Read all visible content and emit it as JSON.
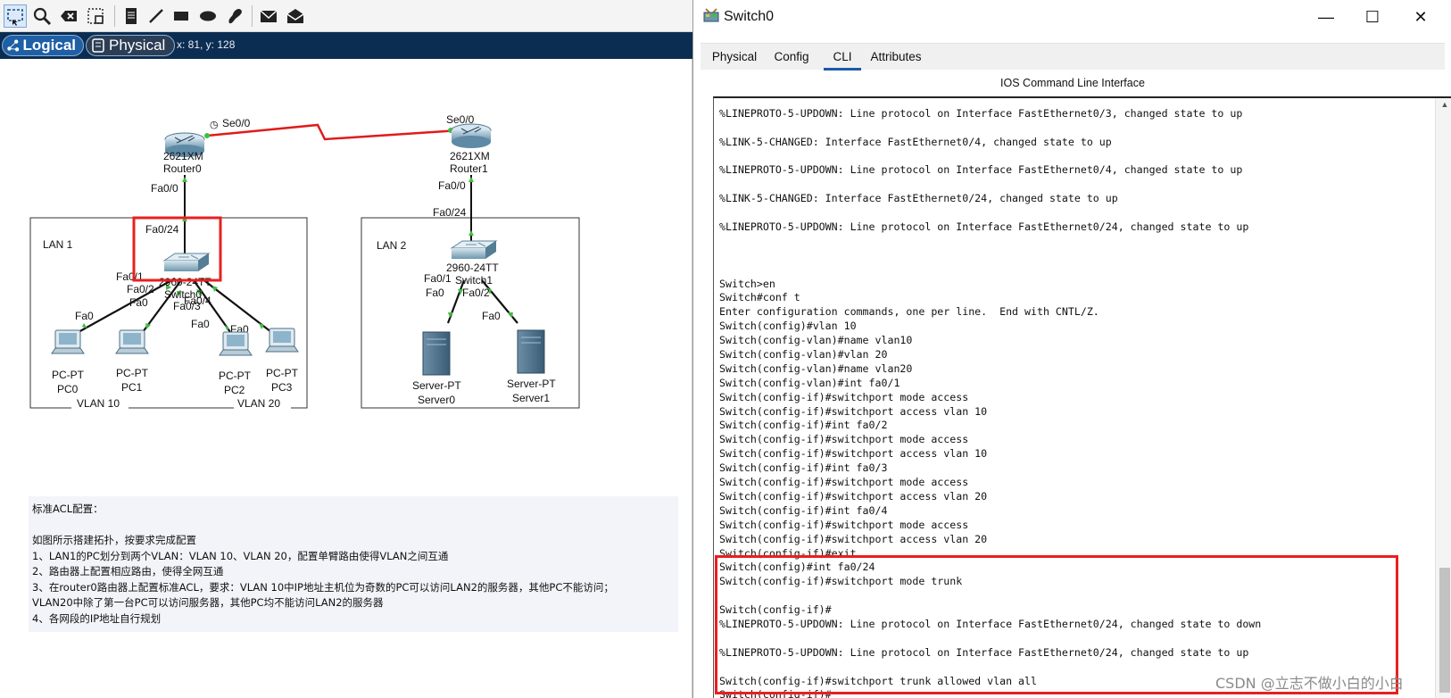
{
  "mode_bar": {
    "logical_label": "Logical",
    "physical_label": "Physical",
    "coordinates": "x: 81, y: 128"
  },
  "toolbar": {
    "tools": [
      "select-icon",
      "inspect-icon",
      "delete-icon",
      "resize-icon",
      "note-icon",
      "draw-line-icon",
      "draw-rectangle-icon",
      "draw-ellipse-icon",
      "freeform-icon",
      "add-simple-pdu-icon",
      "add-complex-pdu-icon"
    ]
  },
  "topology": {
    "routers": [
      {
        "model": "2621XM",
        "name": "Router0"
      },
      {
        "model": "2621XM",
        "name": "Router1"
      }
    ],
    "switches": [
      {
        "model": "2960-24TT",
        "name": "Switch0"
      },
      {
        "model": "2960-24TT",
        "name": "Switch1"
      }
    ],
    "lans": [
      "LAN 1",
      "LAN 2"
    ],
    "vlans": [
      "VLAN 10",
      "VLAN 20"
    ],
    "pcs": [
      {
        "type": "PC-PT",
        "name": "PC0"
      },
      {
        "type": "PC-PT",
        "name": "PC1"
      },
      {
        "type": "PC-PT",
        "name": "PC2"
      },
      {
        "type": "PC-PT",
        "name": "PC3"
      }
    ],
    "servers": [
      {
        "type": "Server-PT",
        "name": "Server0"
      },
      {
        "type": "Server-PT",
        "name": "Server1"
      }
    ],
    "ports": {
      "r0_serial": "Se0/0",
      "r1_serial": "Se0/0",
      "r0_fa": "Fa0/0",
      "r1_fa": "Fa0/0",
      "sw0_uplink": "Fa0/24",
      "sw1_uplink": "Fa0/24",
      "sw0_fa1": "Fa0/1",
      "sw0_fa2": "Fa0/2",
      "sw0_fa3": "Fa0/3",
      "sw0_fa4": "Fa0/4",
      "sw1_fa1": "Fa0/1",
      "sw1_fa2": "Fa0/2",
      "pc_fa": "Fa0"
    },
    "link_color": "#e01b1b",
    "highlight_color": "#e8201f"
  },
  "notes": {
    "lines": [
      "标准ACL配置：",
      "",
      "如图所示搭建拓扑，按要求完成配置",
      "1、LAN1的PC划分到两个VLAN：VLAN 10、VLAN 20，配置单臂路由使得VLAN之间互通",
      "2、路由器上配置相应路由，使得全网互通",
      "3、在router0路由器上配置标准ACL，要求：VLAN 10中IP地址主机位为奇数的PC可以访问LAN2的服务器，其他PC不能访问；",
      "VLAN20中除了第一台PC可以访问服务器，其他PC均不能访问LAN2的服务器",
      "4、各网段的IP地址自行规划"
    ]
  },
  "window": {
    "title": "Switch0",
    "minimize": "—",
    "maximize": "☐",
    "close": "✕",
    "tabs": [
      "Physical",
      "Config",
      "CLI",
      "Attributes"
    ],
    "active_tab": "CLI",
    "heading": "IOS Command Line Interface"
  },
  "cli": {
    "lines": [
      "",
      "%LINEPROTO-5-UPDOWN: Line protocol on Interface FastEthernet0/3, changed state to up",
      "",
      "%LINK-5-CHANGED: Interface FastEthernet0/4, changed state to up",
      "",
      "%LINEPROTO-5-UPDOWN: Line protocol on Interface FastEthernet0/4, changed state to up",
      "",
      "%LINK-5-CHANGED: Interface FastEthernet0/24, changed state to up",
      "",
      "%LINEPROTO-5-UPDOWN: Line protocol on Interface FastEthernet0/24, changed state to up",
      "",
      "",
      "",
      "Switch>en",
      "Switch#conf t",
      "Enter configuration commands, one per line.  End with CNTL/Z.",
      "Switch(config)#vlan 10",
      "Switch(config-vlan)#name vlan10",
      "Switch(config-vlan)#vlan 20",
      "Switch(config-vlan)#name vlan20",
      "Switch(config-vlan)#int fa0/1",
      "Switch(config-if)#switchport mode access",
      "Switch(config-if)#switchport access vlan 10",
      "Switch(config-if)#int fa0/2",
      "Switch(config-if)#switchport mode access",
      "Switch(config-if)#switchport access vlan 10",
      "Switch(config-if)#int fa0/3",
      "Switch(config-if)#switchport mode access",
      "Switch(config-if)#switchport access vlan 20",
      "Switch(config-if)#int fa0/4",
      "Switch(config-if)#switchport mode access",
      "Switch(config-if)#switchport access vlan 20",
      "Switch(config-if)#exit",
      "Switch(config)#int fa0/24",
      "Switch(config-if)#switchport mode trunk",
      "",
      "Switch(config-if)#",
      "%LINEPROTO-5-UPDOWN: Line protocol on Interface FastEthernet0/24, changed state to down",
      "",
      "%LINEPROTO-5-UPDOWN: Line protocol on Interface FastEthernet0/24, changed state to up",
      "",
      "Switch(config-if)#switchport trunk allowed vlan all",
      "Switch(config-if)#"
    ]
  },
  "watermark": "CSDN @立志不做小白的小白"
}
